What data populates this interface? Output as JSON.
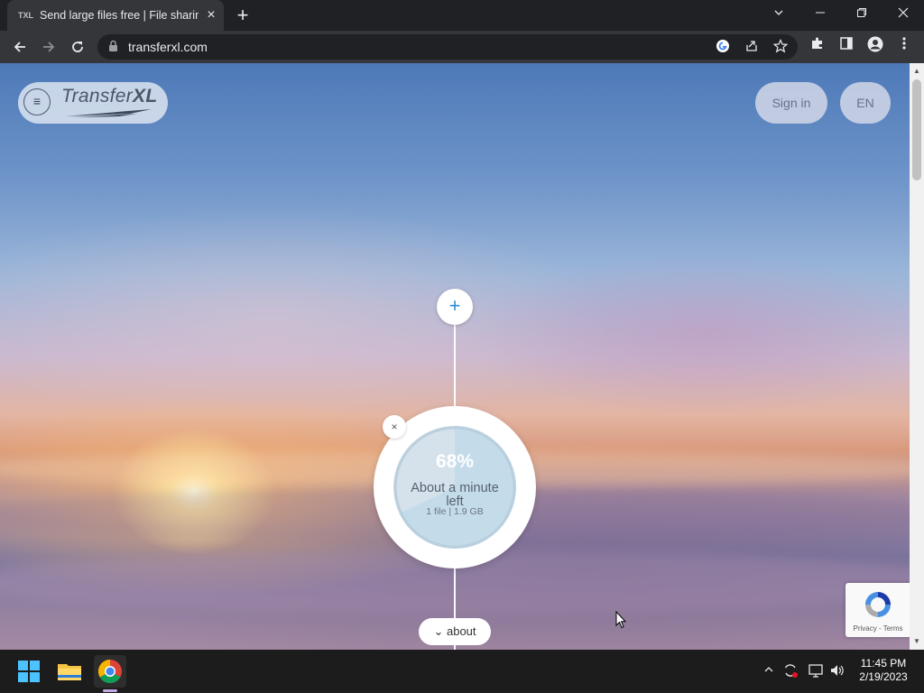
{
  "browser": {
    "tab_title": "Send large files free | File sharing",
    "tab_favicon": "TXL",
    "url": "transferxl.com"
  },
  "site": {
    "logo_text_light": "Transfer",
    "logo_text_bold": "XL",
    "signin_label": "Sign in",
    "language_label": "EN",
    "add_label": "+",
    "cancel_label": "×",
    "about_label": "about",
    "about_chevron": "⌄"
  },
  "upload": {
    "percent": "68%",
    "progress_fraction": 0.68,
    "eta": "About a minute left",
    "info": "1 file | 1.9 GB"
  },
  "recaptcha": {
    "links": "Privacy - Terms"
  },
  "taskbar": {
    "time": "11:45 PM",
    "date": "2/19/2023"
  },
  "colors": {
    "accent_blue": "#2a8ed6",
    "progress_fill": "#c4dcea",
    "progress_track": "#d5e2ec"
  }
}
